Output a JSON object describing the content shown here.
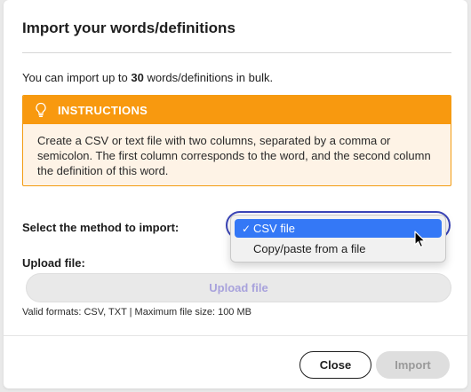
{
  "dialog": {
    "title": "Import your words/definitions",
    "intro_prefix": "You can import up to ",
    "intro_count": "30",
    "intro_suffix": " words/definitions in bulk."
  },
  "instructions": {
    "icon": "lightbulb-icon",
    "header": "INSTRUCTIONS",
    "body": "Create a CSV or text file with two columns, separated by a comma or semicolon. The first column corresponds to the word, and the second column the definition of this word.",
    "accent_color": "#f8990f",
    "background_color": "#fef3e6"
  },
  "method": {
    "label": "Select the method to import:",
    "options": [
      {
        "label": "CSV file",
        "selected": true,
        "check": "✓"
      },
      {
        "label": "Copy/paste from a file",
        "selected": false,
        "check": ""
      }
    ],
    "focus_ring_color": "#3b45b8",
    "highlight_color": "#3478f6"
  },
  "upload": {
    "label": "Upload file:",
    "button_label": "Upload file",
    "formats_note": "Valid formats: CSV, TXT | Maximum file size: 100 MB"
  },
  "footer": {
    "close_label": "Close",
    "import_label": "Import"
  }
}
